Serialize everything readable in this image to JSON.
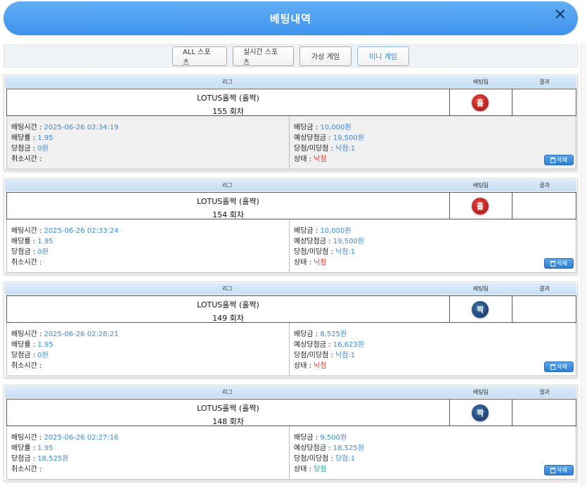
{
  "header": {
    "title": "베팅내역",
    "close_symbol": "✕"
  },
  "tabs": [
    {
      "label": "ALL 스포츠"
    },
    {
      "label": "실시간 스포츠"
    },
    {
      "label": "가상 게임"
    },
    {
      "label": "미니 게임"
    }
  ],
  "columns": {
    "league": "리그",
    "team": "배팅팀",
    "result": "결과"
  },
  "labels": {
    "bet_time": "배팅시간 :",
    "odds": "배당률 :",
    "win_amount": "당첨금 :",
    "cancel_time": "취소시간 :",
    "bet_amount": "배당금 :",
    "expected_win": "예상당첨금 :",
    "win_lose": "당첨/미당첨 :",
    "status": "상태 :",
    "delete": "삭제"
  },
  "bets": [
    {
      "game": "LOTUS홀짝 (홀짝)",
      "round": "155 회차",
      "pick": "홀",
      "result": "",
      "bet_time": "2025-06-26 02:34:19",
      "odds": "1.95",
      "win_amount": "0원",
      "cancel_time": "",
      "bet_amount": "10,000원",
      "expected_win": "19,500원",
      "win_lose": "낙첨:1",
      "status": "낙첨"
    },
    {
      "game": "LOTUS홀짝 (홀짝)",
      "round": "154 회차",
      "pick": "홀",
      "result": "",
      "bet_time": "2025-06-26 02:33:24",
      "odds": "1.95",
      "win_amount": "0원",
      "cancel_time": "",
      "bet_amount": "10,000원",
      "expected_win": "19,500원",
      "win_lose": "낙첨:1",
      "status": "낙첨"
    },
    {
      "game": "LOTUS홀짝 (홀짝)",
      "round": "149 회차",
      "pick": "짝",
      "result": "",
      "bet_time": "2025-06-26 02:28:21",
      "odds": "1.95",
      "win_amount": "0원",
      "cancel_time": "",
      "bet_amount": "8,525원",
      "expected_win": "16,623원",
      "win_lose": "낙첨:1",
      "status": "낙첨"
    },
    {
      "game": "LOTUS홀짝 (홀짝)",
      "round": "148 회차",
      "pick": "짝",
      "result": "",
      "bet_time": "2025-06-26 02:27:16",
      "odds": "1.95",
      "win_amount": "18,525원",
      "cancel_time": "",
      "bet_amount": "9,500원",
      "expected_win": "18,525원",
      "win_lose": "당첨:1",
      "status": "당첨"
    }
  ],
  "colors": {
    "header": "#3d93ec",
    "pick_odd": "#c41e1e",
    "pick_even": "#1f467a",
    "value": "#3a8ad8",
    "lose": "#e0332c",
    "win": "#19a98f"
  }
}
